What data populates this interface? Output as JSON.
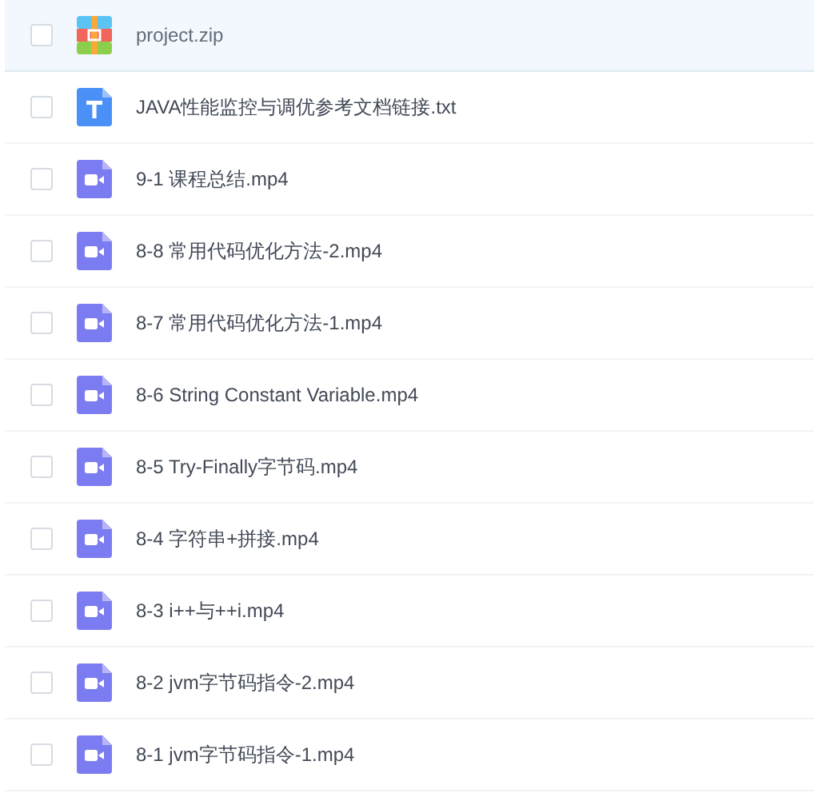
{
  "files": [
    {
      "name": "project.zip",
      "kind": "archive",
      "selected": true,
      "checked": false
    },
    {
      "name": "JAVA性能监控与调优参考文档链接.txt",
      "kind": "text",
      "selected": false,
      "checked": false
    },
    {
      "name": "9-1 课程总结.mp4",
      "kind": "video",
      "selected": false,
      "checked": false
    },
    {
      "name": "8-8 常用代码优化方法-2.mp4",
      "kind": "video",
      "selected": false,
      "checked": false
    },
    {
      "name": "8-7 常用代码优化方法-1.mp4",
      "kind": "video",
      "selected": false,
      "checked": false
    },
    {
      "name": "8-6 String Constant Variable.mp4",
      "kind": "video",
      "selected": false,
      "checked": false
    },
    {
      "name": "8-5 Try-Finally字节码.mp4",
      "kind": "video",
      "selected": false,
      "checked": false
    },
    {
      "name": "8-4 字符串+拼接.mp4",
      "kind": "video",
      "selected": false,
      "checked": false
    },
    {
      "name": "8-3 i++与++i.mp4",
      "kind": "video",
      "selected": false,
      "checked": false
    },
    {
      "name": "8-2 jvm字节码指令-2.mp4",
      "kind": "video",
      "selected": false,
      "checked": false
    },
    {
      "name": "8-1 jvm字节码指令-1.mp4",
      "kind": "video",
      "selected": false,
      "checked": false
    }
  ]
}
